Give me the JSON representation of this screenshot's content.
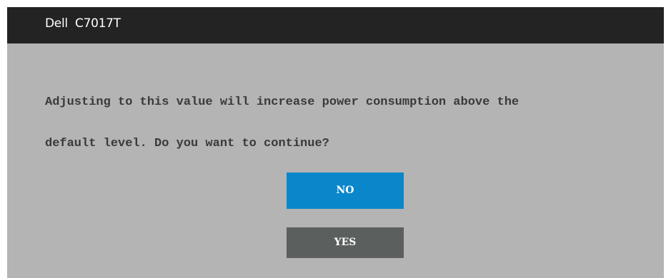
{
  "window": {
    "title": "Dell  C7017T"
  },
  "dialog": {
    "message_line1": "Adjusting to this value will increase power consumption above the",
    "message_line2": "default level. Do you want to continue?"
  },
  "buttons": {
    "no_label": "NO",
    "yes_label": "YES"
  },
  "colors": {
    "title_bar": "#232323",
    "dialog_background": "#b4b4b4",
    "no_button": "#0a87cb",
    "yes_button": "#5b5f5e",
    "message_text": "#3a3a3a"
  }
}
